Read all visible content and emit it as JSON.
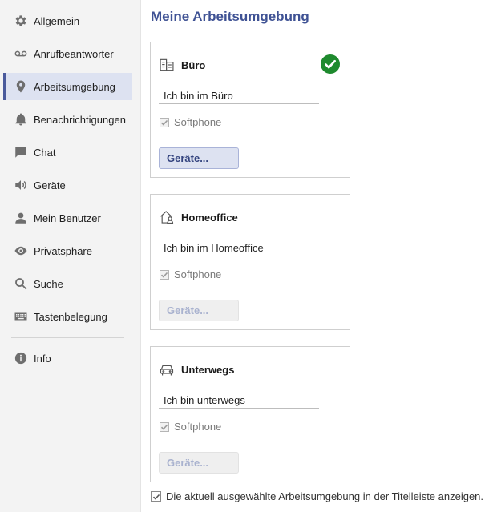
{
  "sidebar": {
    "items": [
      {
        "label": "Allgemein",
        "icon": "gear-icon"
      },
      {
        "label": "Anrufbeantworter",
        "icon": "voicemail-icon"
      },
      {
        "label": "Arbeitsumgebung",
        "icon": "location-pin-icon",
        "active": true
      },
      {
        "label": "Benachrichtigungen",
        "icon": "bell-icon"
      },
      {
        "label": "Chat",
        "icon": "chat-bubble-icon"
      },
      {
        "label": "Geräte",
        "icon": "speaker-icon"
      },
      {
        "label": "Mein Benutzer",
        "icon": "user-icon"
      },
      {
        "label": "Privatsphäre",
        "icon": "eye-icon"
      },
      {
        "label": "Suche",
        "icon": "search-icon"
      },
      {
        "label": "Tastenbelegung",
        "icon": "keyboard-icon"
      },
      {
        "label": "Info",
        "icon": "info-icon"
      }
    ]
  },
  "main": {
    "title": "Meine Arbeitsumgebung",
    "cards": [
      {
        "title": "Büro",
        "status_value": "Ich bin im Büro",
        "softphone_label": "Softphone",
        "softphone_checked": true,
        "devices_button": "Geräte...",
        "devices_enabled": true,
        "selected": true,
        "icon": "office-building-icon"
      },
      {
        "title": "Homeoffice",
        "status_value": "Ich bin im Homeoffice",
        "softphone_label": "Softphone",
        "softphone_checked": true,
        "devices_button": "Geräte...",
        "devices_enabled": false,
        "selected": false,
        "icon": "home-person-icon"
      },
      {
        "title": "Unterwegs",
        "status_value": "Ich bin unterwegs",
        "softphone_label": "Softphone",
        "softphone_checked": true,
        "devices_button": "Geräte...",
        "devices_enabled": false,
        "selected": false,
        "icon": "car-icon"
      }
    ],
    "footer_checkbox": {
      "label": "Die aktuell ausgewählte Arbeitsumgebung in der Titelleiste anzeigen.",
      "checked": true
    }
  },
  "colors": {
    "accent": "#3f5294",
    "active_bg": "#dde2f1",
    "check_green": "#1e8a2e"
  }
}
